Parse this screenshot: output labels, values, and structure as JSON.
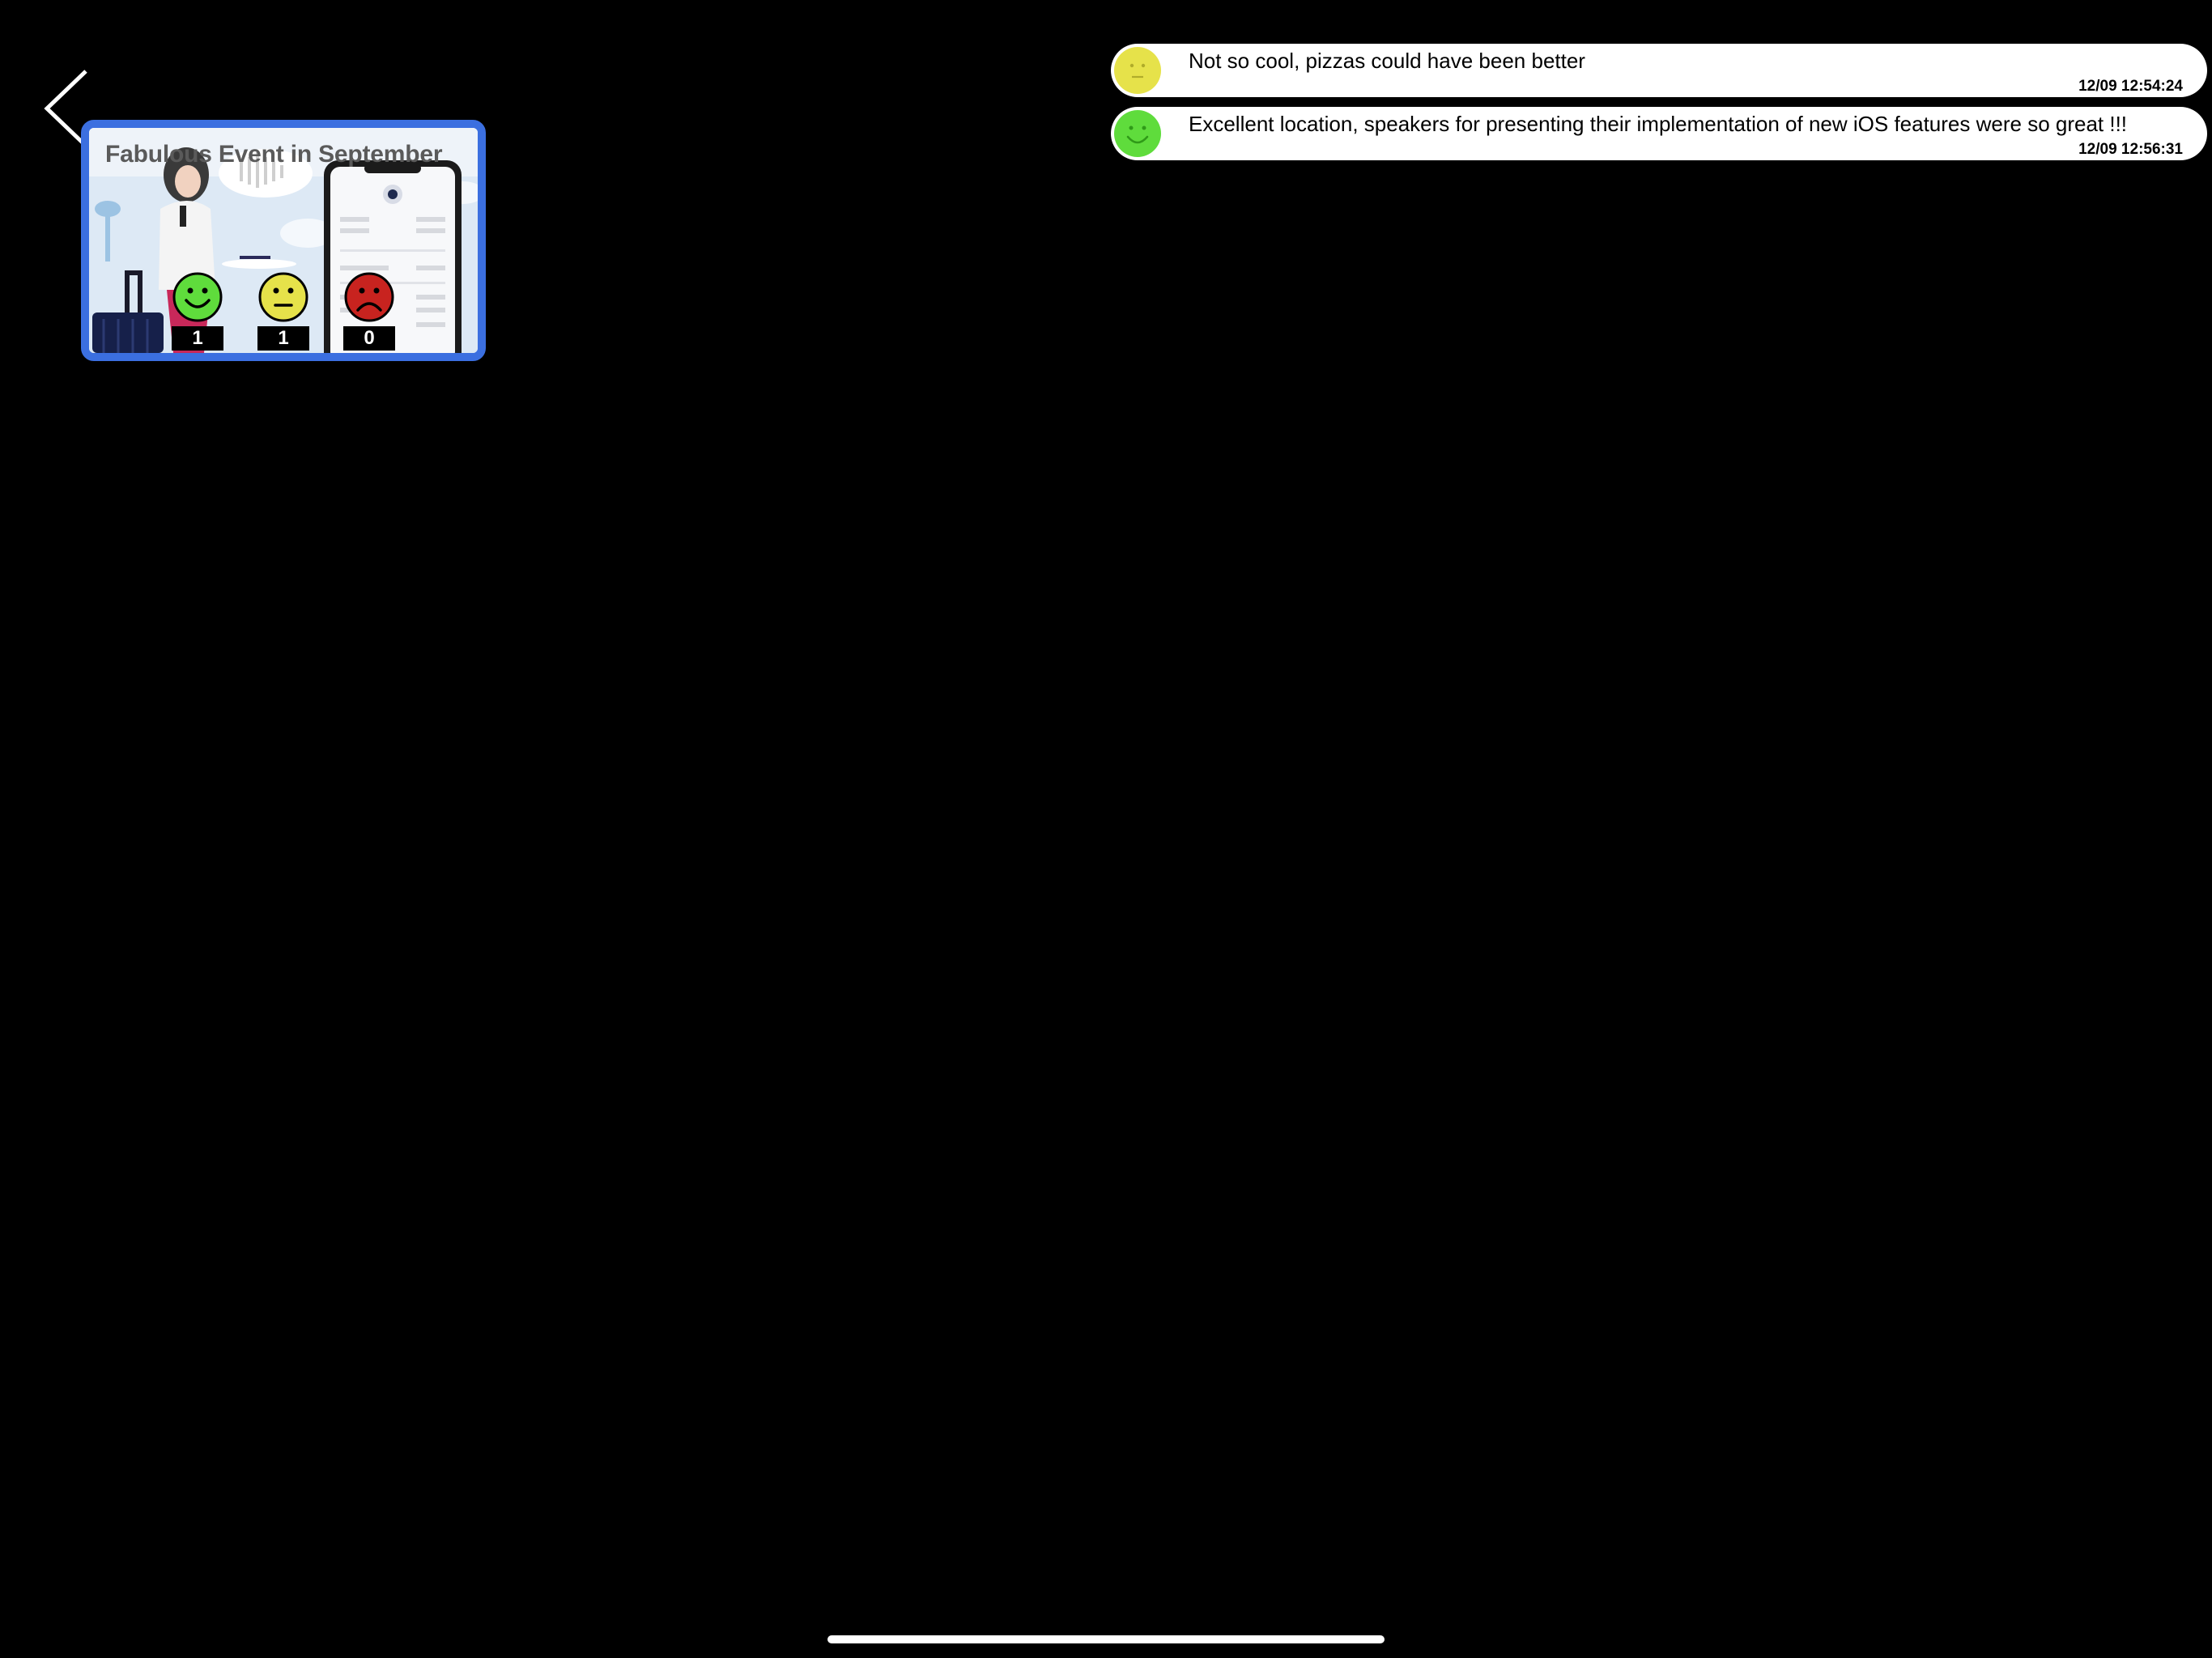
{
  "navigation": {
    "back_icon": "chevron-left-icon"
  },
  "event": {
    "title": "Fabulous Event in September",
    "illustration": "traveler-with-phone-illustration",
    "ratings": [
      {
        "mood": "happy",
        "icon": "happy-face-icon",
        "color": "#5fdc3c",
        "count": "1"
      },
      {
        "mood": "neutral",
        "icon": "neutral-face-icon",
        "color": "#e6e24a",
        "count": "1"
      },
      {
        "mood": "sad",
        "icon": "sad-face-icon",
        "color": "#c8231f",
        "count": "0"
      }
    ]
  },
  "comments": [
    {
      "mood": "neutral",
      "avatar_icon": "neutral-face-icon",
      "avatar_color": "#e6e24a",
      "text": "Not so cool, pizzas could have been better",
      "timestamp": "12/09 12:54:24"
    },
    {
      "mood": "happy",
      "avatar_icon": "happy-face-icon",
      "avatar_color": "#5fdc3c",
      "text": "Excellent location, speakers for presenting their implementation of new iOS features were so great !!!",
      "timestamp": "12/09 12:56:31"
    }
  ],
  "colors": {
    "background": "#000000",
    "card_border": "#3b6fe0",
    "bubble": "#ffffff"
  }
}
